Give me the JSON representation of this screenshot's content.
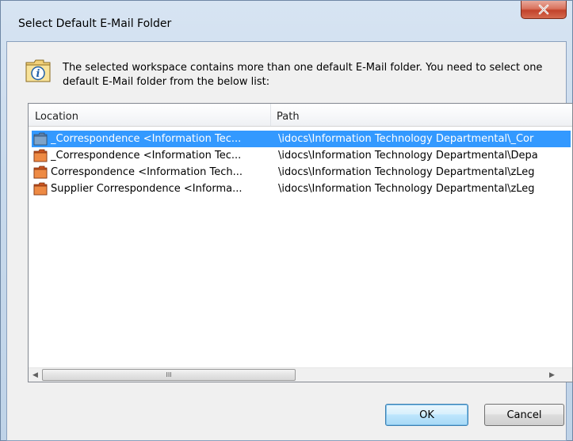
{
  "window": {
    "title": "Select Default E-Mail Folder"
  },
  "message": "The selected workspace contains more than one default E-Mail folder. You need to select one default E-Mail folder from the below list:",
  "list": {
    "columns": [
      "Location",
      "Path"
    ],
    "rows": [
      {
        "location": "_Correspondence <Information Tec...",
        "path": "\\idocs\\Information Technology Departmental\\_Cor",
        "selected": true
      },
      {
        "location": "_Correspondence <Information Tec...",
        "path": "\\idocs\\Information Technology Departmental\\Depa",
        "selected": false
      },
      {
        "location": "Correspondence <Information Tech...",
        "path": "\\idocs\\Information Technology Departmental\\zLeg",
        "selected": false
      },
      {
        "location": "Supplier Correspondence <Informa...",
        "path": "\\idocs\\Information Technology Departmental\\zLeg",
        "selected": false
      }
    ],
    "scroll_thumb_grip": "III"
  },
  "buttons": {
    "ok": "OK",
    "cancel": "Cancel"
  },
  "colors": {
    "selection": "#3399ff",
    "close_button": "#c2432b",
    "folder_icon": "#d9652e"
  },
  "icons": {
    "close": "close-icon",
    "info": "info-folder-icon",
    "folder": "email-folder-icon"
  }
}
